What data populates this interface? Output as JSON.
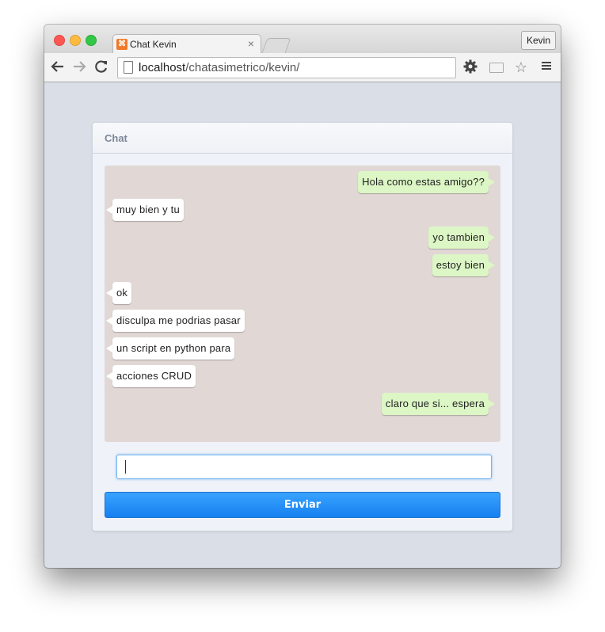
{
  "browser": {
    "tab_title": "Chat Kevin",
    "tab_close": "×",
    "profile_label": "Kevin",
    "url_host": "localhost",
    "url_path": "/chatasimetrico/kevin/"
  },
  "icons": {
    "back": "back-arrow-icon",
    "forward": "forward-arrow-icon",
    "reload": "reload-icon",
    "page": "page-icon",
    "settings": "gear-icon",
    "cast": "cast-icon",
    "bookmark": "star-icon",
    "menu": "hamburger-menu-icon"
  },
  "colors": {
    "bubble_incoming": "#ffffff",
    "bubble_outgoing": "#dcf6c5",
    "chat_background": "#e1d8d6",
    "send_button": "#2a90f8"
  },
  "chat": {
    "title": "Chat",
    "messages": [
      {
        "text": "Hola como estas amigo??",
        "side": "right"
      },
      {
        "text": "muy bien y tu",
        "side": "left"
      },
      {
        "text": "yo tambien",
        "side": "right"
      },
      {
        "text": "estoy bien",
        "side": "right"
      },
      {
        "text": "ok",
        "side": "left"
      },
      {
        "text": "disculpa me podrias pasar",
        "side": "left"
      },
      {
        "text": "un script en python para",
        "side": "left"
      },
      {
        "text": "acciones CRUD",
        "side": "left"
      },
      {
        "text": "claro que si... espera",
        "side": "right"
      }
    ],
    "input_value": "",
    "send_label": "Enviar"
  }
}
